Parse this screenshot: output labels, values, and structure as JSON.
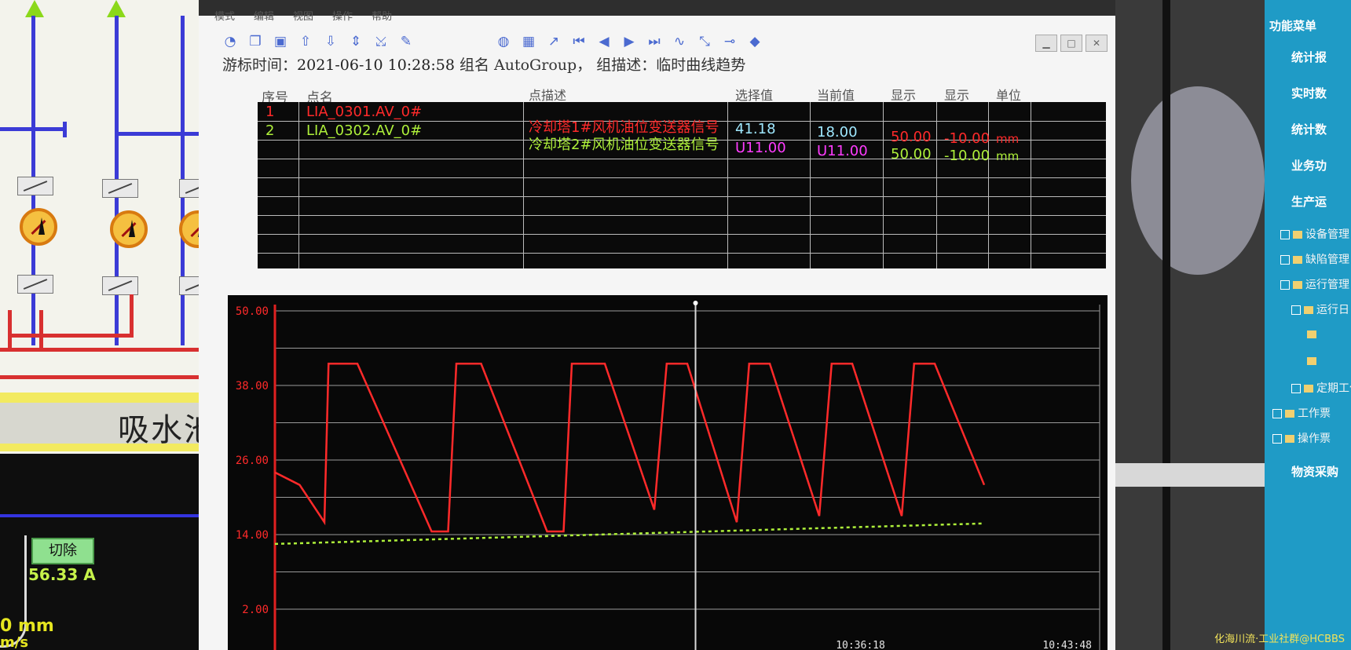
{
  "scada": {
    "pool_label": "吸水池",
    "cut_button": "切除",
    "current": "56.33 A",
    "level_unit": "0 mm",
    "speed_unit": "m/s"
  },
  "window": {
    "menu": [
      "模式",
      "编辑",
      "视图",
      "操作",
      "帮助"
    ],
    "cursor_label": "游标时间：",
    "cursor_time": "2021-06-10 10:28:58",
    "group_label": "组名 AutoGroup，",
    "group_desc": "组描述：临时曲线趋势"
  },
  "table": {
    "headers": {
      "seq": "序号",
      "point": "点名",
      "desc": "点描述",
      "selected": "选择值",
      "current": "当前值",
      "display_max": "显示",
      "display_min": "显示",
      "unit": "单位"
    },
    "rows": [
      {
        "seq": "1",
        "point": "LIA_0301.AV_0#",
        "desc": "冷却塔1#风机油位变送器信号",
        "selected": "41.18",
        "current": "18.00",
        "max": "50.00",
        "min": "-10.00",
        "unit": "mm",
        "color": "#ff2a2a"
      },
      {
        "seq": "2",
        "point": "LIA_0302.AV_0#",
        "desc": "冷却塔2#风机油位变送器信号",
        "selected": "U11.00",
        "current": "U11.00",
        "max": "50.00",
        "min": "-10.00",
        "unit": "mm",
        "color": "#aef03a"
      }
    ]
  },
  "chart_data": {
    "type": "line",
    "ylim": [
      2,
      50
    ],
    "y_ticks": [
      "50.00",
      "38.00",
      "26.00",
      "14.00",
      "2.00"
    ],
    "x_tick_labels": [
      "10:36:18",
      "10:43:48"
    ],
    "grid": true,
    "cursor_time": "10:28:58",
    "series": [
      {
        "color": "#ff2a2a",
        "points": [
          [
            0,
            24
          ],
          [
            0.3,
            22
          ],
          [
            0.6,
            16
          ],
          [
            0.65,
            41.5
          ],
          [
            1.0,
            41.5
          ],
          [
            1.9,
            14.5
          ],
          [
            2.1,
            14.5
          ],
          [
            2.2,
            41.5
          ],
          [
            2.5,
            41.5
          ],
          [
            3.3,
            14.5
          ],
          [
            3.5,
            14.5
          ],
          [
            3.6,
            41.5
          ],
          [
            4.0,
            41.5
          ],
          [
            4.6,
            18
          ],
          [
            4.75,
            41.5
          ],
          [
            5.0,
            41.5
          ],
          [
            5.6,
            16
          ],
          [
            5.75,
            41.5
          ],
          [
            6.0,
            41.5
          ],
          [
            6.6,
            17
          ],
          [
            6.75,
            41.5
          ],
          [
            7.0,
            41.5
          ],
          [
            7.6,
            17
          ],
          [
            7.75,
            41.5
          ],
          [
            8.0,
            41.5
          ],
          [
            8.6,
            22
          ]
        ]
      },
      {
        "color": "#aef03a",
        "points": [
          [
            0,
            12.5
          ],
          [
            8.6,
            15.8
          ]
        ]
      }
    ]
  },
  "app_menu": {
    "items": [
      "功能菜单",
      "统计报",
      "实时数",
      "统计数",
      "业务功",
      "生产运"
    ],
    "tree": [
      "设备管理",
      "缺陷管理",
      "运行管理",
      "运行日",
      "定期工作",
      "工作票",
      "操作票"
    ],
    "bottom": "物资采购"
  },
  "watermark": "化海川流·工业社群@HCBBS"
}
